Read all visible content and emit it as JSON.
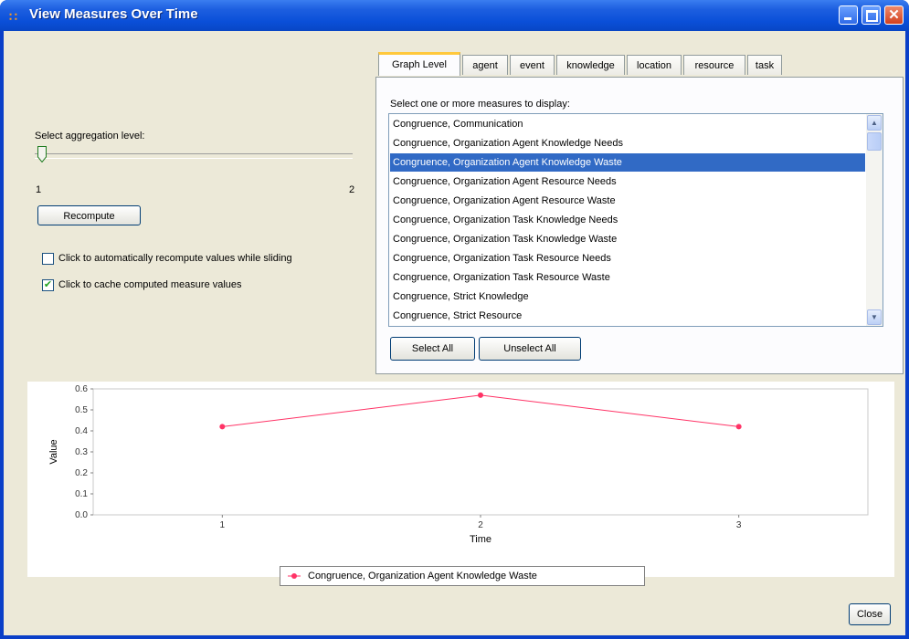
{
  "window": {
    "title": "View Measures Over Time"
  },
  "left": {
    "aggregation_label": "Select aggregation level:",
    "slider_min_label": "1",
    "slider_max_label": "2",
    "slider_value": 1,
    "recompute_label": "Recompute",
    "auto_recompute_label": "Click to automatically recompute values while sliding",
    "auto_recompute_checked": false,
    "cache_label": "Click to cache computed measure values",
    "cache_checked": true
  },
  "tabs": [
    {
      "label": "Graph Level",
      "active": true
    },
    {
      "label": "agent"
    },
    {
      "label": "event"
    },
    {
      "label": "knowledge"
    },
    {
      "label": "location"
    },
    {
      "label": "resource"
    },
    {
      "label": "task"
    }
  ],
  "panel": {
    "prompt": "Select one or more measures to display:",
    "items": [
      "Congruence, Communication",
      "Congruence, Organization Agent Knowledge Needs",
      "Congruence, Organization Agent Knowledge Waste",
      "Congruence, Organization Agent Resource Needs",
      "Congruence, Organization Agent Resource Waste",
      "Congruence, Organization Task Knowledge Needs",
      "Congruence, Organization Task Knowledge Waste",
      "Congruence, Organization Task Resource Needs",
      "Congruence, Organization Task Resource Waste",
      "Congruence, Strict Knowledge",
      "Congruence, Strict Resource"
    ],
    "selected_index": 2,
    "select_all_label": "Select All",
    "unselect_all_label": "Unselect All"
  },
  "chart_data": {
    "type": "line",
    "x": [
      1,
      2,
      3
    ],
    "series": [
      {
        "name": "Congruence, Organization Agent Knowledge Waste",
        "values": [
          0.42,
          0.57,
          0.42
        ],
        "color": "#ff3366"
      }
    ],
    "xlabel": "Time",
    "ylabel": "Value",
    "xticks": [
      "1",
      "2",
      "3"
    ],
    "yticks": [
      "0.0",
      "0.1",
      "0.2",
      "0.3",
      "0.4",
      "0.5",
      "0.6"
    ],
    "ylim": [
      0,
      0.6
    ],
    "legend": "bottom"
  },
  "footer": {
    "close_label": "Close"
  }
}
